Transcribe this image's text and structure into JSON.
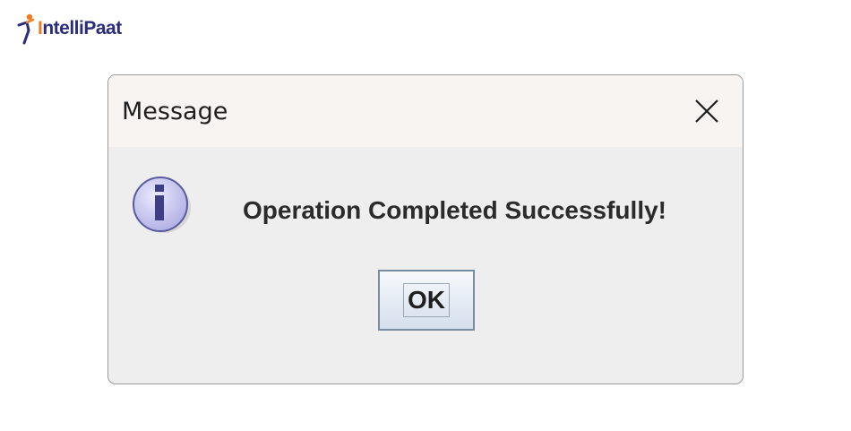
{
  "logo": {
    "initial": "I",
    "text_main": "ntelliPaat",
    "icon": "intellipaat-figure-icon",
    "colors": {
      "primary": "#2a2d7c",
      "accent": "#f27c21"
    }
  },
  "dialog": {
    "title": "Message",
    "close_icon": "close-icon",
    "message_icon": "info-icon",
    "message": "Operation Completed Successfully!",
    "ok_label": "OK"
  },
  "colors": {
    "titlebar_bg": "#f8f4f1",
    "body_bg": "#eeeeee",
    "info_icon_fill": "#c9c8f0",
    "info_icon_stroke": "#5b5a9e"
  }
}
